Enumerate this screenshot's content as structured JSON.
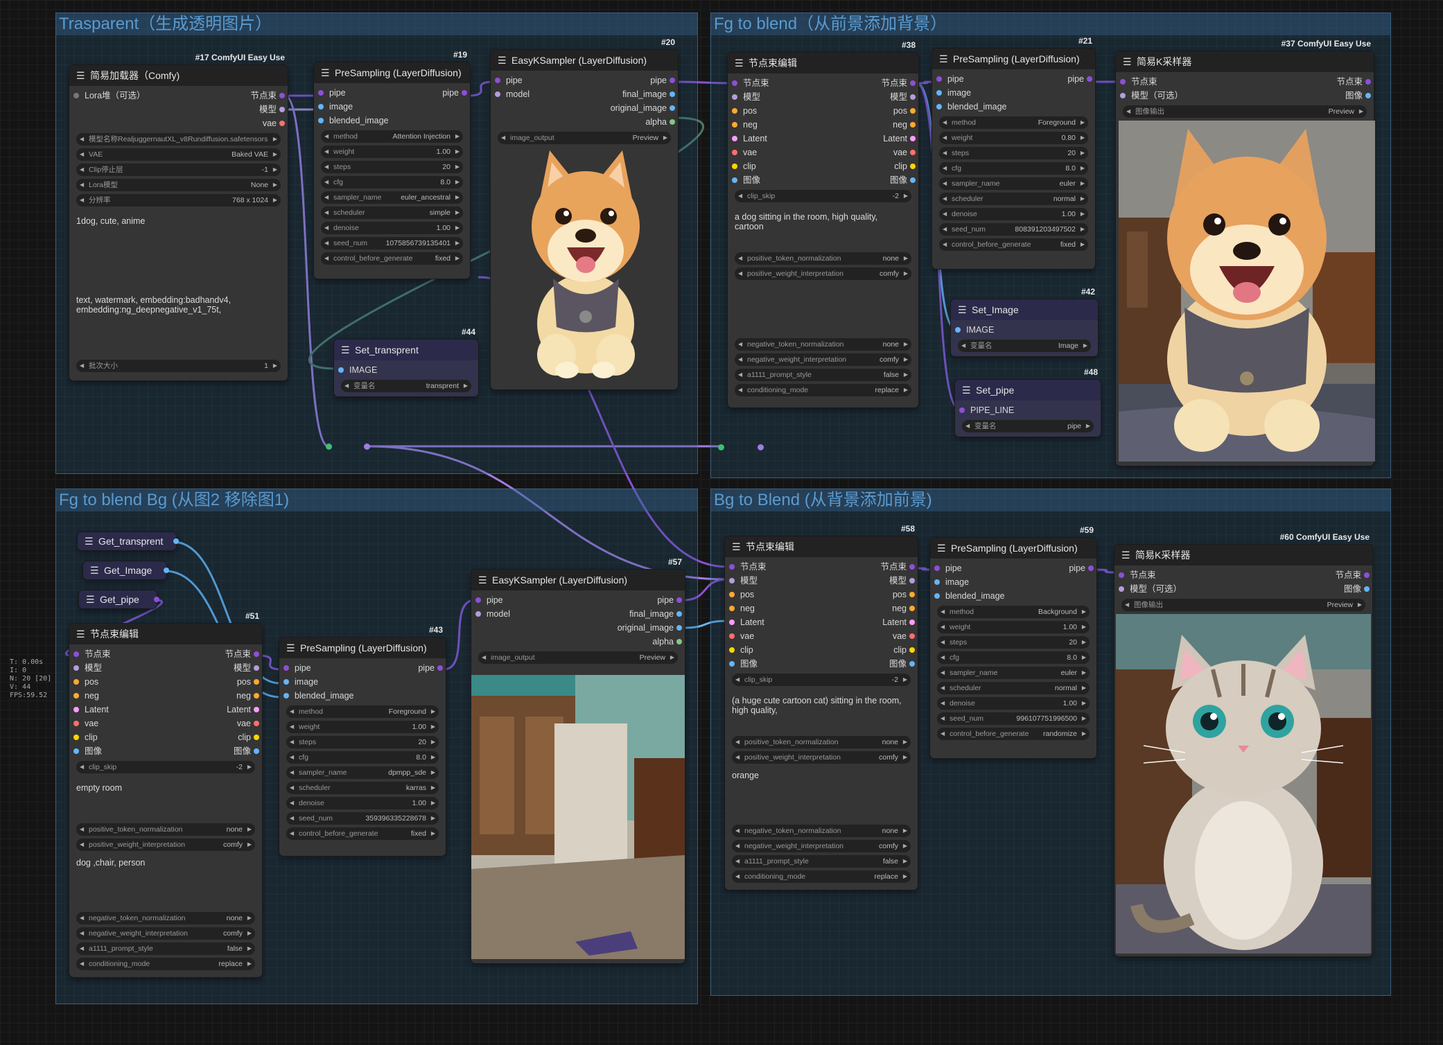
{
  "groups": [
    {
      "title": "Trasparent（生成透明图片）"
    },
    {
      "title": "Fg to blend（从前景添加背景）"
    },
    {
      "title": "Fg to blend Bg (从图2 移除图1)"
    },
    {
      "title": "Bg to Blend (从背景添加前景)"
    }
  ],
  "n17": {
    "id": "#17 ComfyUI Easy Use",
    "title": "简易加载器（Comfy)",
    "in": "Lora堆（可选）",
    "out": [
      "节点束",
      "模型",
      "vae"
    ],
    "widgets": [
      [
        "模型名称RealjuggernautXL_v8Rundiffusion.safetensors",
        ""
      ],
      [
        "VAE",
        "Baked VAE"
      ],
      [
        "Clip停止层",
        "-1"
      ],
      [
        "Lora模型",
        "None"
      ],
      [
        "分辨率",
        "768 x 1024"
      ]
    ],
    "pos": "1dog, cute, anime",
    "neg": "text, watermark, embedding:badhandv4,\nembedding:ng_deepnegative_v1_75t,",
    "batch": [
      "批次大小",
      "1"
    ]
  },
  "n19": {
    "id": "#19",
    "title": "PreSampling (LayerDiffusion)",
    "in": [
      "pipe",
      "image",
      "blended_image"
    ],
    "out": "pipe",
    "widgets": [
      [
        "method",
        "Attention Injection"
      ],
      [
        "weight",
        "1.00"
      ],
      [
        "steps",
        "20"
      ],
      [
        "cfg",
        "8.0"
      ],
      [
        "sampler_name",
        "euler_ancestral"
      ],
      [
        "scheduler",
        "simple"
      ],
      [
        "denoise",
        "1.00"
      ],
      [
        "seed_num",
        "1075856739135401"
      ],
      [
        "control_before_generate",
        "fixed"
      ]
    ]
  },
  "n20": {
    "id": "#20",
    "title": "EasyKSampler (LayerDiffusion)",
    "in": [
      "pipe",
      "model"
    ],
    "out": [
      "pipe",
      "final_image",
      "original_image",
      "alpha"
    ],
    "widget": [
      "image_output",
      "Preview"
    ]
  },
  "n44": {
    "id": "#44",
    "title": "Set_transprent",
    "row": "IMAGE",
    "widget": [
      "变量名",
      "transprent"
    ]
  },
  "n38": {
    "id": "#38",
    "title": "节点束编辑",
    "in": [
      "节点束",
      "模型",
      "pos",
      "neg",
      "Latent",
      "vae",
      "clip",
      "图像"
    ],
    "out": [
      "节点束",
      "模型",
      "pos",
      "neg",
      "Latent",
      "vae",
      "clip",
      "图像"
    ],
    "clip": [
      "clip_skip",
      "-2"
    ],
    "text": "a dog sitting in the room, high quality,\ncartoon",
    "w1": [
      [
        "positive_token_normalization",
        "none"
      ],
      [
        "positive_weight_interpretation",
        "comfy"
      ]
    ],
    "w2": [
      [
        "negative_token_normalization",
        "none"
      ],
      [
        "negative_weight_interpretation",
        "comfy"
      ],
      [
        "a1111_prompt_style",
        "false"
      ],
      [
        "conditioning_mode",
        "replace"
      ]
    ]
  },
  "n21": {
    "id": "#21",
    "title": "PreSampling (LayerDiffusion)",
    "in": [
      "pipe",
      "image",
      "blended_image"
    ],
    "out": "pipe",
    "widgets": [
      [
        "method",
        "Foreground"
      ],
      [
        "weight",
        "0.80"
      ],
      [
        "steps",
        "20"
      ],
      [
        "cfg",
        "8.0"
      ],
      [
        "sampler_name",
        "euler"
      ],
      [
        "scheduler",
        "normal"
      ],
      [
        "denoise",
        "1.00"
      ],
      [
        "seed_num",
        "808391203497502"
      ],
      [
        "control_before_generate",
        "fixed"
      ]
    ]
  },
  "n42": {
    "id": "#42",
    "title": "Set_Image",
    "row": "IMAGE",
    "widget": [
      "变量名",
      "Image"
    ]
  },
  "n48": {
    "id": "#48",
    "title": "Set_pipe",
    "row": "PIPE_LINE",
    "widget": [
      "变量名",
      "pipe"
    ]
  },
  "n37": {
    "id": "#37 ComfyUI Easy Use",
    "title": "简易K采样器",
    "in": [
      "节点束",
      "模型（可选）"
    ],
    "out": [
      "节点束",
      "图像"
    ],
    "widget": [
      "图像输出",
      "Preview"
    ]
  },
  "gets": [
    {
      "title": "Get_transprent"
    },
    {
      "title": "Get_Image"
    },
    {
      "title": "Get_pipe"
    }
  ],
  "n51": {
    "id": "#51",
    "title": "节点束编辑",
    "in": [
      "节点束",
      "模型",
      "pos",
      "neg",
      "Latent",
      "vae",
      "clip",
      "图像"
    ],
    "out": [
      "节点束",
      "模型",
      "pos",
      "neg",
      "Latent",
      "vae",
      "clip",
      "图像"
    ],
    "clip": [
      "clip_skip",
      "-2"
    ],
    "text": "empty room",
    "w1": [
      [
        "positive_token_normalization",
        "none"
      ],
      [
        "positive_weight_interpretation",
        "comfy"
      ]
    ],
    "text2": "dog ,chair, person",
    "w2": [
      [
        "negative_token_normalization",
        "none"
      ],
      [
        "negative_weight_interpretation",
        "comfy"
      ],
      [
        "a1111_prompt_style",
        "false"
      ],
      [
        "conditioning_mode",
        "replace"
      ]
    ]
  },
  "n43": {
    "id": "#43",
    "title": "PreSampling (LayerDiffusion)",
    "in": [
      "pipe",
      "image",
      "blended_image"
    ],
    "out": "pipe",
    "widgets": [
      [
        "method",
        "Foreground"
      ],
      [
        "weight",
        "1.00"
      ],
      [
        "steps",
        "20"
      ],
      [
        "cfg",
        "8.0"
      ],
      [
        "sampler_name",
        "dpmpp_sde"
      ],
      [
        "scheduler",
        "karras"
      ],
      [
        "denoise",
        "1.00"
      ],
      [
        "seed_num",
        "359396335228678"
      ],
      [
        "control_before_generate",
        "fixed"
      ]
    ]
  },
  "n57": {
    "id": "#57",
    "title": "EasyKSampler (LayerDiffusion)",
    "in": [
      "pipe",
      "model"
    ],
    "out": [
      "pipe",
      "final_image",
      "original_image",
      "alpha"
    ],
    "widget": [
      "image_output",
      "Preview"
    ]
  },
  "n58": {
    "id": "#58",
    "title": "节点束编辑",
    "in": [
      "节点束",
      "模型",
      "pos",
      "neg",
      "Latent",
      "vae",
      "clip",
      "图像"
    ],
    "out": [
      "节点束",
      "模型",
      "pos",
      "neg",
      "Latent",
      "vae",
      "clip",
      "图像"
    ],
    "clip": [
      "clip_skip",
      "-2"
    ],
    "text": "(a huge cute cartoon cat) sitting in the room,\nhigh quality,",
    "w1": [
      [
        "positive_token_normalization",
        "none"
      ],
      [
        "positive_weight_interpretation",
        "comfy"
      ]
    ],
    "text2": "orange",
    "w2": [
      [
        "negative_token_normalization",
        "none"
      ],
      [
        "negative_weight_interpretation",
        "comfy"
      ],
      [
        "a1111_prompt_style",
        "false"
      ],
      [
        "conditioning_mode",
        "replace"
      ]
    ]
  },
  "n59": {
    "id": "#59",
    "title": "PreSampling (LayerDiffusion)",
    "in": [
      "pipe",
      "image",
      "blended_image"
    ],
    "out": "pipe",
    "widgets": [
      [
        "method",
        "Background"
      ],
      [
        "weight",
        "1.00"
      ],
      [
        "steps",
        "20"
      ],
      [
        "cfg",
        "8.0"
      ],
      [
        "sampler_name",
        "euler"
      ],
      [
        "scheduler",
        "normal"
      ],
      [
        "denoise",
        "1.00"
      ],
      [
        "seed_num",
        "996107751996500"
      ],
      [
        "control_before_generate",
        "randomize"
      ]
    ]
  },
  "n60": {
    "id": "#60 ComfyUI Easy Use",
    "title": "简易K采样器",
    "in": [
      "节点束",
      "模型（可选）"
    ],
    "out": [
      "节点束",
      "图像"
    ],
    "widget": [
      "图像输出",
      "Preview"
    ]
  },
  "stats": [
    "T: 0.00s",
    "I: 0",
    "N: 20 [20]",
    "V: 44",
    "FPS:59.52"
  ],
  "colors": {
    "pipe": "#8d4fd6",
    "image": "#64b5f6",
    "vae": "#ff6e6e",
    "model": "#b39ddb",
    "latent": "#ff9cf9",
    "clip": "#ffd500",
    "cond": "#ffa931",
    "mask": "#81c784",
    "link_pipe": "#a37be0",
    "link_img": "#64b5f6",
    "link_green": "#4a7a66"
  }
}
